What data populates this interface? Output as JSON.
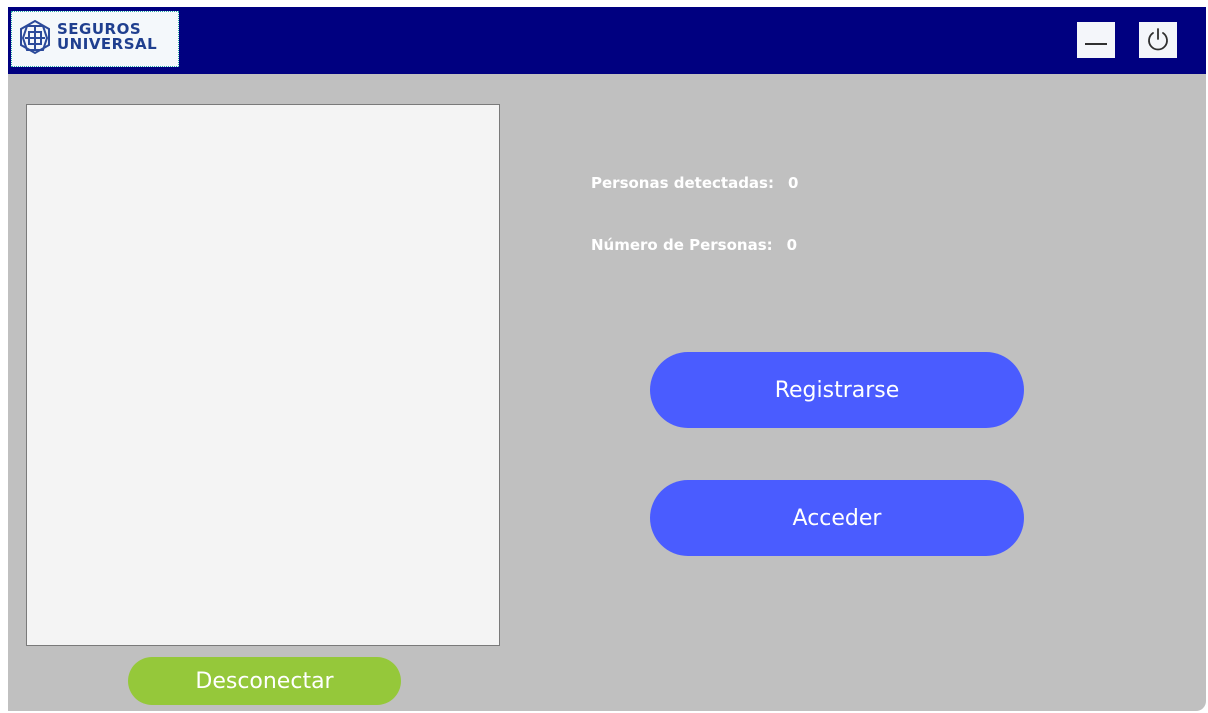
{
  "app": {
    "logo_text_line1": "SEGUROS",
    "logo_text_line2": "UNIVERSAL"
  },
  "titlebar": {
    "background": "#000080",
    "buttons": [
      {
        "name": "minimize-button",
        "icon": "minimize-icon"
      },
      {
        "name": "power-button",
        "icon": "power-icon"
      }
    ]
  },
  "stats": {
    "detected_label": "Personas detectadas:",
    "detected_value": "0",
    "count_label": "Número de Personas:",
    "count_value": "0"
  },
  "actions": {
    "register_label": "Registrarse",
    "access_label": "Acceder",
    "disconnect_label": "Desconectar"
  },
  "colors": {
    "window_bg": "#c0c0c0",
    "primary_button": "#4a5cff",
    "disconnect_button": "#95c83a",
    "camera_bg": "#f4f4f4"
  }
}
